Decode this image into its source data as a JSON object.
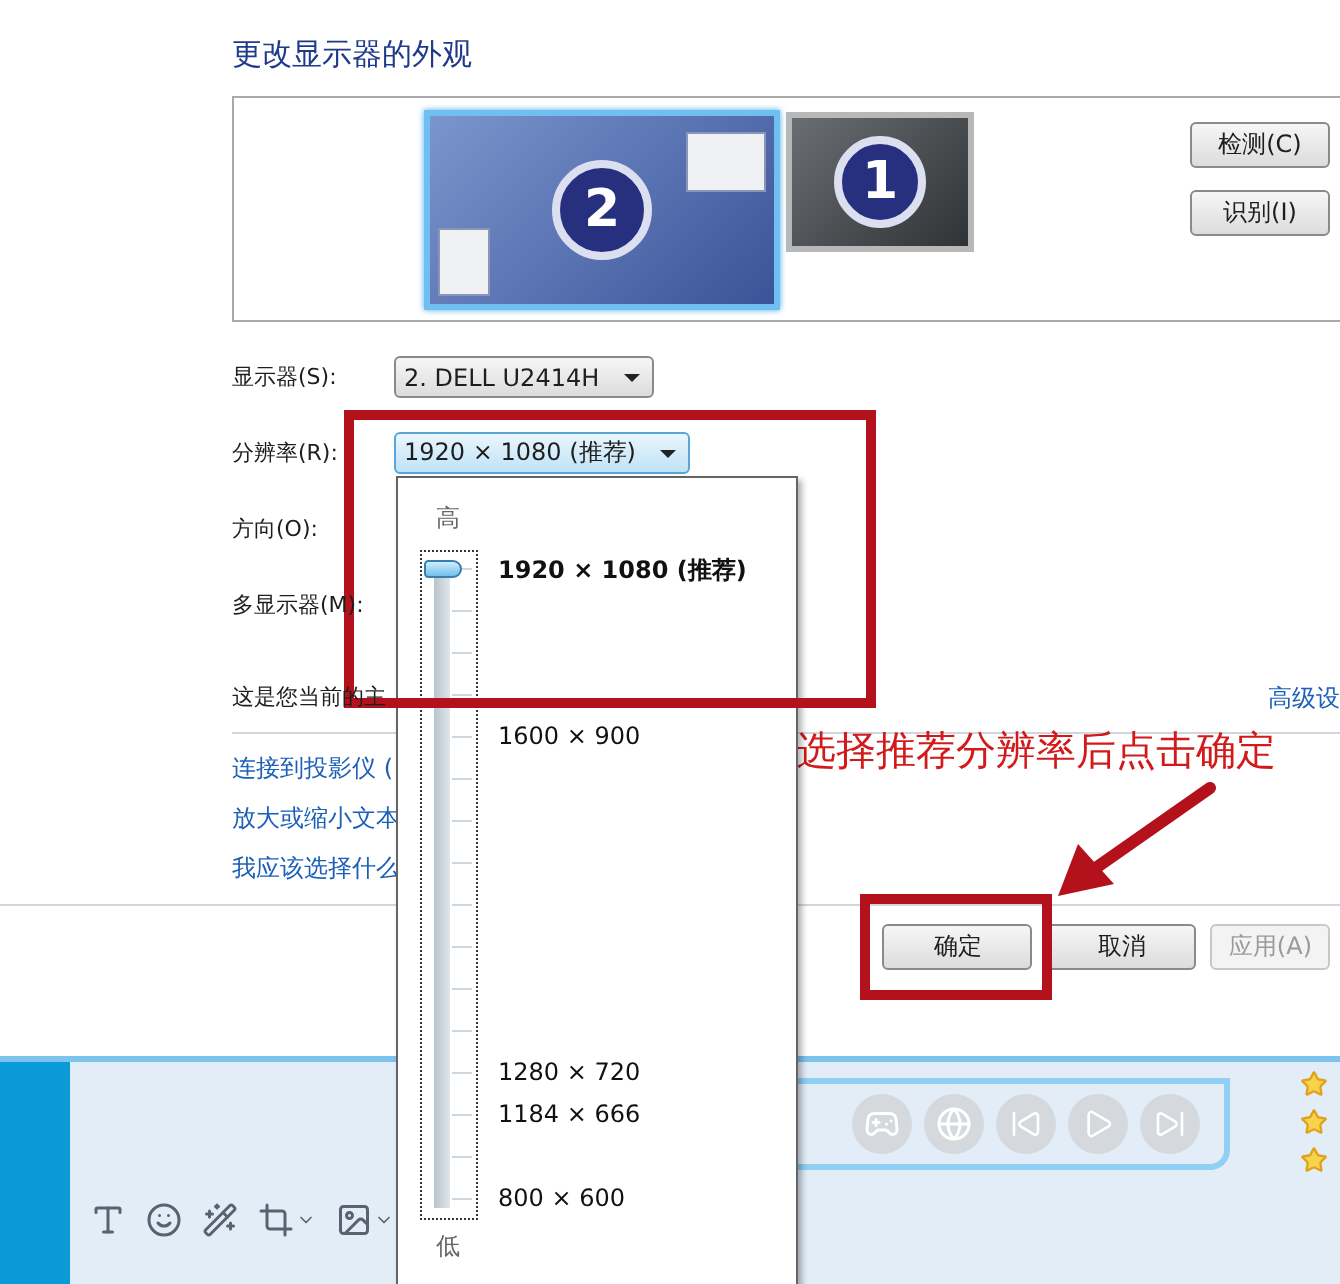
{
  "dialog": {
    "title": "更改显示器的外观",
    "monitors": [
      {
        "label": "2",
        "selected": true
      },
      {
        "label": "1",
        "selected": false
      }
    ],
    "side_buttons": [
      "检测(C)",
      "识别(I)"
    ],
    "fields": [
      {
        "label": "显示器(S):",
        "value": "2. DELL U2414H"
      },
      {
        "label": "分辨率(R):",
        "value": "1920 × 1080 (推荐)"
      },
      {
        "label": "方向(O):"
      },
      {
        "label": "多显示器(M):"
      }
    ],
    "note": "这是您当前的主",
    "advanced_link": "高级设",
    "links": [
      "连接到投影仪 (",
      "放大或缩小文本",
      "我应该选择什么"
    ],
    "buttons": [
      {
        "label": "确定",
        "disabled": false
      },
      {
        "label": "取消",
        "disabled": false
      },
      {
        "label": "应用(A)",
        "disabled": true
      }
    ]
  },
  "resolution_dropdown": {
    "high_label": "高",
    "low_label": "低",
    "level": 1,
    "options": [
      {
        "label": "1920 × 1080 (推荐)",
        "selected": true
      },
      {
        "label": "1600 × 900",
        "selected": false
      },
      {
        "label": "1280 × 720",
        "selected": false
      },
      {
        "label": "1184 × 666",
        "selected": false
      },
      {
        "label": "800 × 600",
        "selected": false
      }
    ]
  },
  "annotation": {
    "text": "选择推荐分辨率后点击确定"
  }
}
